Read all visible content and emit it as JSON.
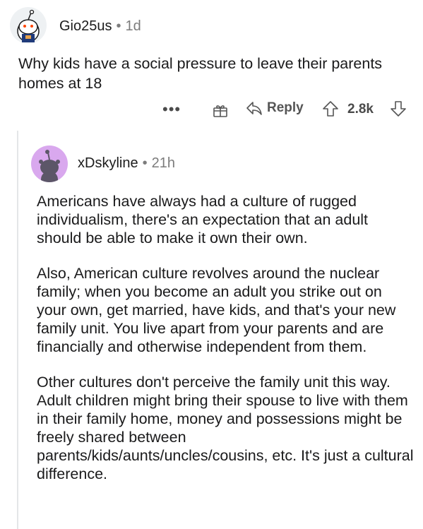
{
  "parent_comment": {
    "username": "Gio25us",
    "age": "1d",
    "text": "Why kids have a social pressure to leave their parents homes at 18",
    "actions": {
      "more": "•••",
      "reply_label": "Reply",
      "score": "2.8k"
    }
  },
  "reply_comment": {
    "username": "xDskyline",
    "age": "21h",
    "paragraphs": [
      "Americans have always had a culture of rugged individualism, there's an expectation that an adult should be able to make it own their own.",
      "Also, American culture revolves around the nuclear family; when you become an adult you strike out on your own, get married, have kids, and that's your new family unit. You live apart from your parents and are financially and otherwise independent from them.",
      "Other cultures don't perceive the family unit this way. Adult children might bring their spouse to live with them in their family home, money and possessions might be freely shared between parents/kids/aunts/uncles/cousins, etc. It's just a cultural difference."
    ]
  },
  "icons": {
    "avatar1": "snoo-avatar-icon",
    "avatar2": "snoo-avatar-icon",
    "award": "gift-icon",
    "reply": "reply-arrow-icon",
    "upvote": "upvote-arrow-icon",
    "downvote": "downvote-arrow-icon"
  },
  "colors": {
    "meta_text": "#7c7c7c",
    "action_text": "#878a8c",
    "avatar2_bg": "#d9a8ee",
    "thread_line": "#e4e6e8"
  }
}
